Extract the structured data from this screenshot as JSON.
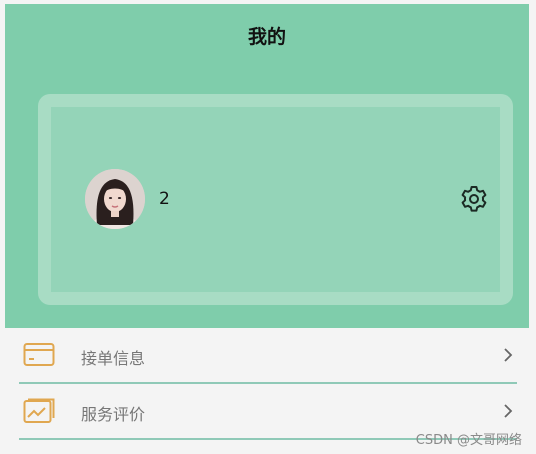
{
  "header": {
    "title": "我的"
  },
  "profile": {
    "username": "2"
  },
  "menu": {
    "items": [
      {
        "label": "接单信息"
      },
      {
        "label": "服务评价"
      }
    ]
  },
  "watermark": "CSDN @文哥网络",
  "colors": {
    "header_bg": "#7fcdab",
    "card_bg": "#94d4b8",
    "accent_icon": "#e0a750",
    "divider": "#8fc9b7"
  }
}
